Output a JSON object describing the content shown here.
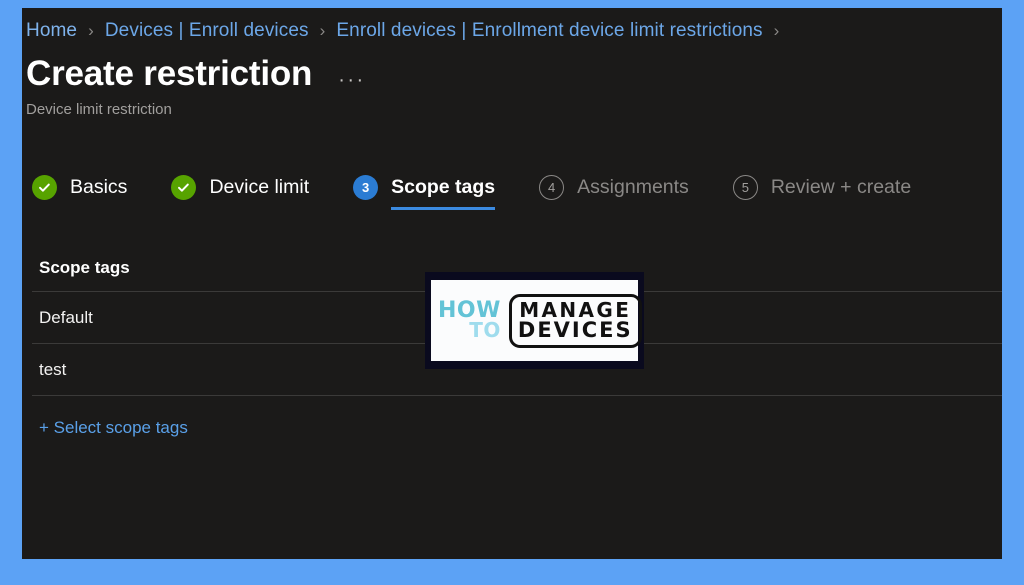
{
  "theme": {
    "outer_border": "#5ca2f5",
    "page_bg": "#1b1a19",
    "link": "#6ca7e8",
    "accent_blue": "#2b7cd3",
    "done_green": "#57a300",
    "divider": "#3b3a39"
  },
  "breadcrumb": {
    "items": [
      {
        "label": "Home"
      },
      {
        "label": "Devices | Enroll devices"
      },
      {
        "label": "Enroll devices | Enrollment device limit restrictions"
      }
    ],
    "separator": "›"
  },
  "header": {
    "title": "Create restriction",
    "subtitle": "Device limit restriction",
    "more_menu": "···"
  },
  "wizard": {
    "steps": [
      {
        "number": "1",
        "label": "Basics",
        "state": "done"
      },
      {
        "number": "2",
        "label": "Device limit",
        "state": "done"
      },
      {
        "number": "3",
        "label": "Scope tags",
        "state": "active"
      },
      {
        "number": "4",
        "label": "Assignments",
        "state": "todo"
      },
      {
        "number": "5",
        "label": "Review + create",
        "state": "todo"
      }
    ]
  },
  "scope_tags": {
    "column_header": "Scope tags",
    "rows": [
      {
        "name": "Default"
      },
      {
        "name": "test"
      }
    ],
    "select_link": "+ Select scope tags"
  },
  "watermark": {
    "how": "HOW",
    "to": "TO",
    "manage": "MANAGE",
    "devices": "DEVICES"
  }
}
